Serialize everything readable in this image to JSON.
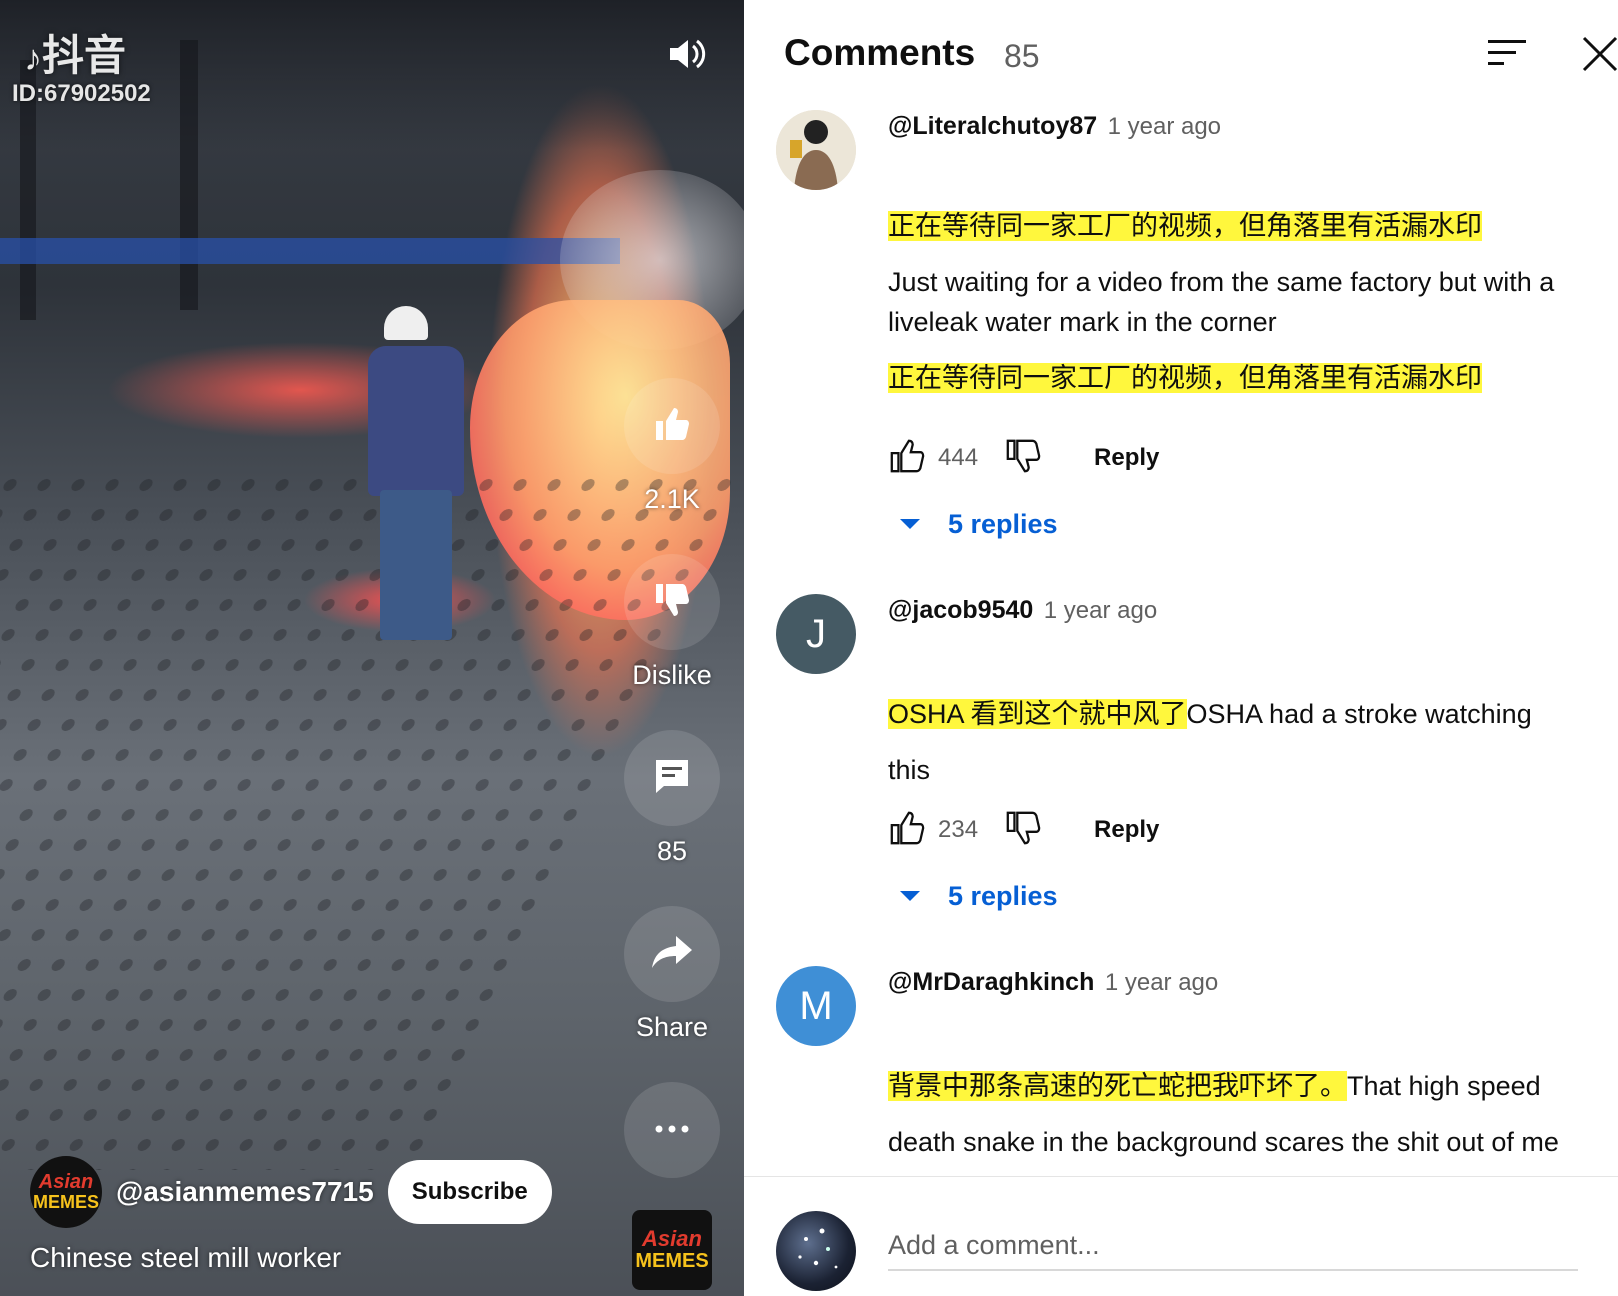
{
  "video": {
    "watermark_logo": "抖音",
    "watermark_id": "ID:67902502",
    "icons": {
      "sound": "speaker-icon",
      "like": "thumb-up-icon",
      "dislike": "thumb-down-icon",
      "comments": "comment-icon",
      "share": "share-icon",
      "more": "more-icon"
    },
    "like_count": "2.1K",
    "dislike_label": "Dislike",
    "comment_count": "85",
    "share_label": "Share",
    "channel_name": "@asianmemes7715",
    "subscribe_label": "Subscribe",
    "title": "Chinese steel mill worker",
    "logo_text_top": "Asian",
    "logo_text_bottom": "MEMES"
  },
  "panel": {
    "title": "Comments",
    "count": "85",
    "icons": {
      "sort": "sort-icon",
      "close": "close-icon"
    }
  },
  "comments": [
    {
      "handle": "@Literalchutoy87",
      "time": "1 year ago",
      "text_line1_zh": "正在等待同一家工厂的视频，但角落里有活漏水印",
      "text_en": "Just waiting for a video from the same factory but with a liveleak water mark in the corner",
      "text_line3_zh": "正在等待同一家工厂的视频，但角落里有活漏水印",
      "likes": "444",
      "reply_label": "Reply",
      "replies_label": "5 replies"
    },
    {
      "handle": "@jacob9540",
      "avatar_letter": "J",
      "time": "1 year ago",
      "text_zh": "OSHA 看到这个就中风了",
      "text_en": "OSHA had a stroke watching this",
      "likes": "234",
      "reply_label": "Reply",
      "replies_label": "5 replies"
    },
    {
      "handle": "@MrDaraghkinch",
      "avatar_letter": "M",
      "time": "1 year ago",
      "text_zh": "背景中那条高速的死亡蛇把我吓坏了。",
      "text_en": "That high speed death snake in the background scares the shit out of me"
    }
  ],
  "composer": {
    "placeholder": "Add a comment..."
  },
  "colors": {
    "highlight": "#fff73d",
    "link_blue": "#065fd4",
    "avatar_j": "#455a64",
    "avatar_m": "#3f8fd6"
  }
}
